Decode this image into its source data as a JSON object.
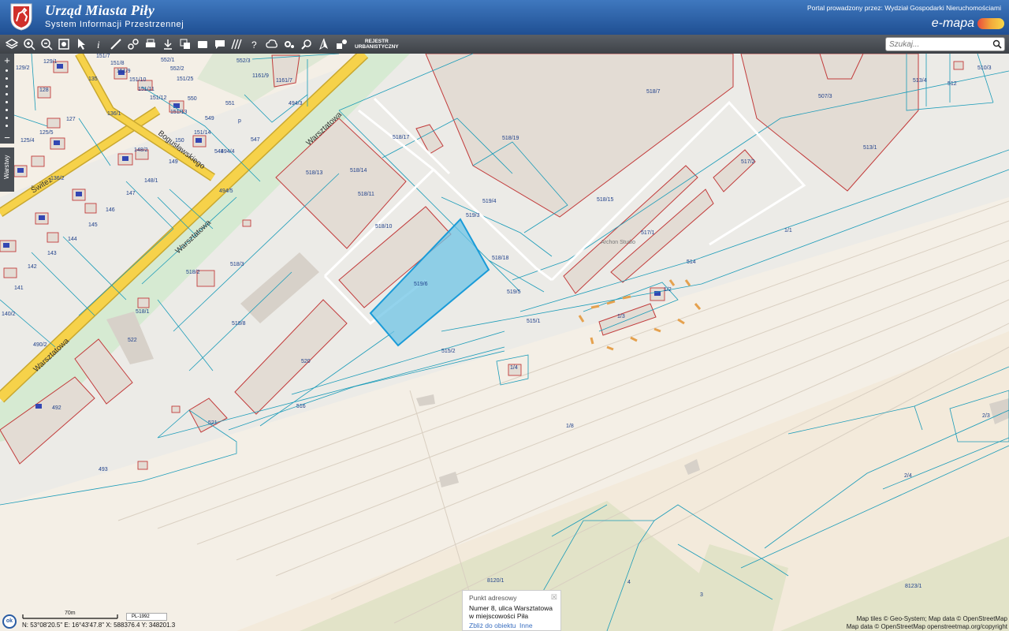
{
  "header": {
    "title": "Urząd Miasta Piły",
    "subtitle": "System Informacji Przestrzennej",
    "portal_text": "Portal prowadzony przez: Wydział Gospodarki Nieruchomościami",
    "brand": "e-mapa"
  },
  "toolbar": {
    "tools": [
      "layers-icon",
      "zoom-in-icon",
      "zoom-out-icon",
      "full-extent-icon",
      "pointer-icon",
      "info-icon",
      "measure-icon",
      "link-icon",
      "print-icon",
      "download-icon",
      "copy-icon",
      "pan-icon",
      "comment-icon",
      "hatch-icon",
      "help-icon",
      "cloud-icon",
      "settings-icon",
      "search-map-icon",
      "north-icon",
      "share-icon"
    ],
    "rejestr_line1": "REJESTR",
    "rejestr_line2": "URBANISTYCZNY",
    "search_placeholder": "Szukaj..."
  },
  "sidebar": {
    "zoom_in": "+",
    "zoom_out": "−",
    "layers_tab": "Warstwy"
  },
  "map": {
    "streets": [
      "Warsztatowa",
      "Warsztatowa",
      "Warsztatowa",
      "Bogusławskiego",
      "Świtez"
    ],
    "parcels": [
      "129/1",
      "129/2",
      "128",
      "127",
      "125/4",
      "125/5",
      "136/1",
      "136/2",
      "135",
      "151/7",
      "151/8",
      "151/9",
      "151/10",
      "151/11",
      "151/12",
      "151/13",
      "151/14",
      "151/25",
      "552/1",
      "552/2",
      "552/3",
      "550",
      "551",
      "549",
      "548",
      "547",
      "494/4",
      "494/5",
      "494/3",
      "1161/9",
      "1161/7",
      "148/2",
      "148/1",
      "147",
      "146",
      "145",
      "144",
      "143",
      "142",
      "141",
      "140/2",
      "149",
      "150",
      "518/17",
      "518/19",
      "518/7",
      "507/3",
      "513/4",
      "512",
      "510/3",
      "513/1",
      "518/13",
      "518/14",
      "518/11",
      "518/15",
      "517/2",
      "519/4",
      "519/3",
      "518/10",
      "517/1",
      "519/6",
      "518/18",
      "519/5",
      "514",
      "1/1",
      "1/2",
      "1/3",
      "515/1",
      "515/2",
      "518/2",
      "518/3",
      "518/1",
      "518/8",
      "522",
      "520",
      "490/2",
      "492",
      "516",
      "521",
      "1/4",
      "1/8",
      "493",
      "2/3",
      "2/4",
      "8120/1",
      "8123/1",
      "4",
      "3",
      "p",
      "Archon Studio"
    ]
  },
  "popup": {
    "title": "Punkt adresowy",
    "close": "☒",
    "line1": "Numer 8, ulica Warsztatowa",
    "line2": "w miejscowości Piła",
    "link_zoom": "Zbliż do obiektu",
    "link_other": "Inne"
  },
  "footer": {
    "ok": "ok",
    "scale": "70m",
    "crs": "PL-1992",
    "coords": "N: 53°08'20.5\"  E: 16°43'47.8\"  X: 588376.4  Y: 348201.3",
    "attrib1": "Map tiles © Geo-System; Map data © OpenStreetMap",
    "attrib2": "Map data © OpenStreetMap openstreetmap.org/copyright"
  },
  "colors": {
    "header": "#2a5ca3",
    "road": "#f6d24a",
    "parcel_line": "#1a9bb8",
    "building_edge": "#c23b3b",
    "selection": "#6fc4e6"
  }
}
